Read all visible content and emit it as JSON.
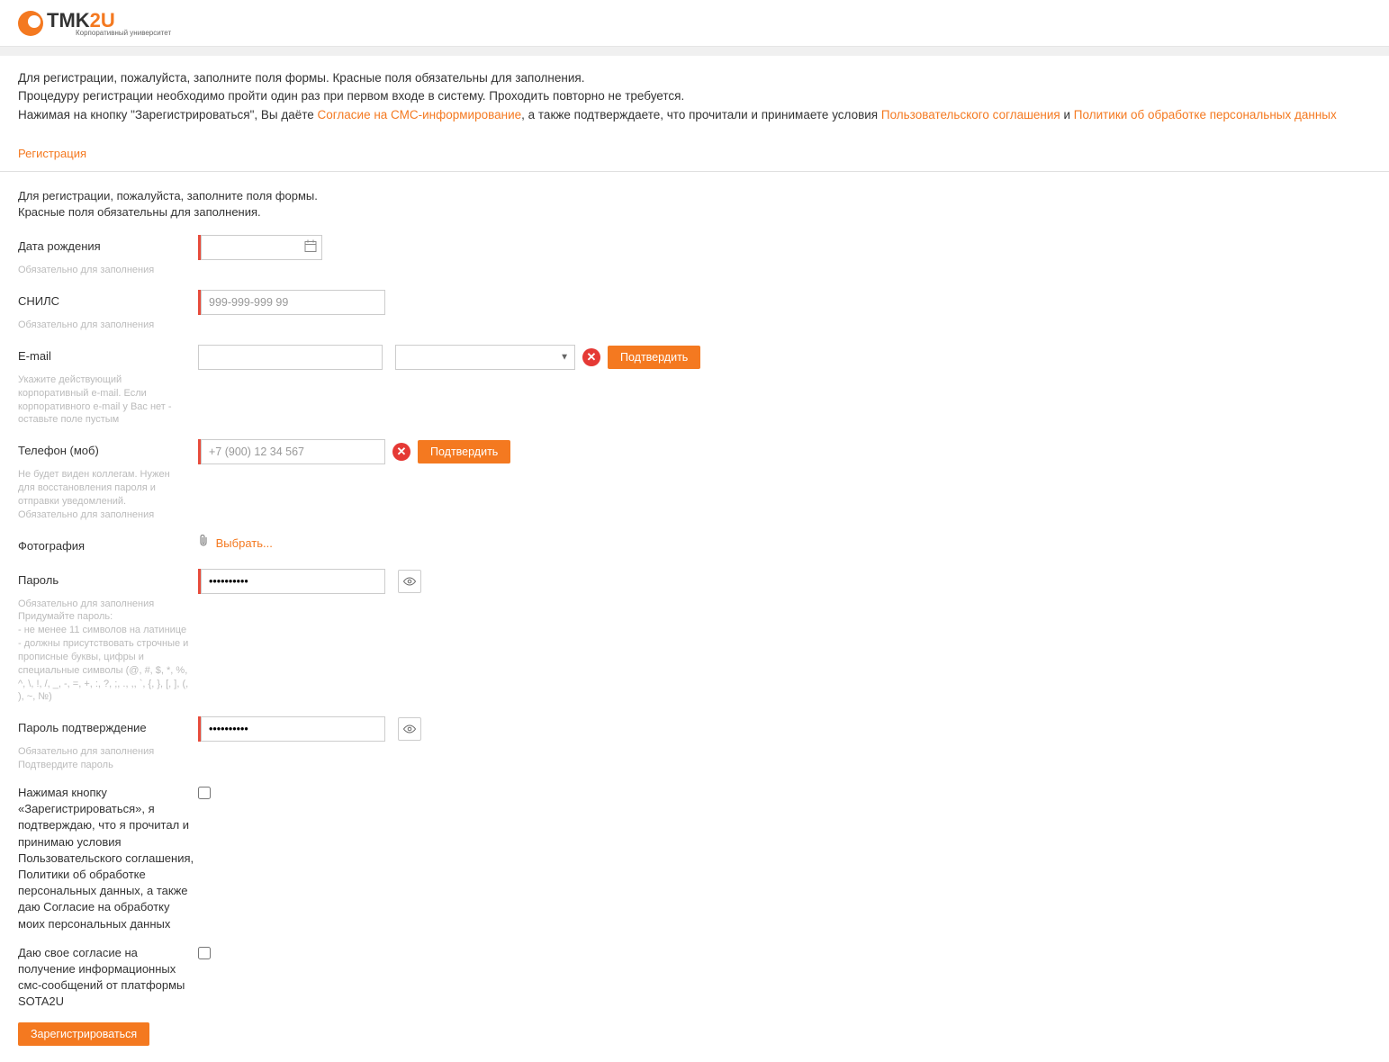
{
  "logo": {
    "main": "TMK",
    "suffix": "2U",
    "subtitle": "Корпоративный университет"
  },
  "intro": {
    "line1": "Для регистрации, пожалуйста, заполните поля формы. Красные поля обязательны для заполнения.",
    "line2": "Процедуру регистрации необходимо пройти один раз при первом входе в систему. Проходить повторно не требуется.",
    "line3_pre": "Нажимая на кнопку \"Зарегистрироваться\", Вы даёте ",
    "link_sms": "Согласие на СМС-информирование",
    "line3_mid": ", а также подтверждаете, что прочитали и принимаете условия ",
    "link_agreement": "Пользовательского соглашения",
    "and": " и ",
    "link_policy": "Политики об обработке персональных данных"
  },
  "page_title": "Регистрация",
  "form_intro": {
    "line1": "Для регистрации, пожалуйста, заполните поля формы.",
    "line2": "Красные поля обязательны для заполнения."
  },
  "fields": {
    "birthdate": {
      "label": "Дата рождения",
      "help": "Обязательно для заполнения"
    },
    "snils": {
      "label": "СНИЛС",
      "placeholder": "999-999-999 99",
      "help": "Обязательно для заполнения"
    },
    "email": {
      "label": "E-mail",
      "confirm": "Подтвердить",
      "help": "Укажите действующий корпоративный e-mail. Если корпоративного e-mail у Вас нет - оставьте поле пустым"
    },
    "phone": {
      "label": "Телефон (моб)",
      "placeholder": "+7 (900) 12 34 567",
      "confirm": "Подтвердить",
      "help": "Не будет виден коллегам. Нужен для восстановления пароля и отправки уведомлений.\nОбязательно для заполнения"
    },
    "photo": {
      "label": "Фотография",
      "choose": "Выбрать..."
    },
    "password": {
      "label": "Пароль",
      "help": "Обязательно для заполнения\nПридумайте пароль:\n- не менее 11 символов на латинице\n- должны присутствовать строчные и прописные буквы, цифры и специальные символы (@, #, $, *, %, ^, \\, !, /, _, -, =, +, :, ?, ;, ., ,, `, {, }, [, ], (, ), ~, №)"
    },
    "password_confirm": {
      "label": "Пароль подтверждение",
      "help": "Обязательно для заполнения\nПодтвердите пароль"
    },
    "agree1": {
      "label": "Нажимая кнопку «Зарегистрироваться», я подтверждаю, что я прочитал и принимаю условия Пользовательского соглашения, Политики об обработке персональных данных, а также даю Согласие на обработку моих персональных данных"
    },
    "agree2": {
      "label": "Даю свое согласие на получение информационных смс-сообщений от платформы SOTA2U"
    }
  },
  "submit": "Зарегистрироваться"
}
